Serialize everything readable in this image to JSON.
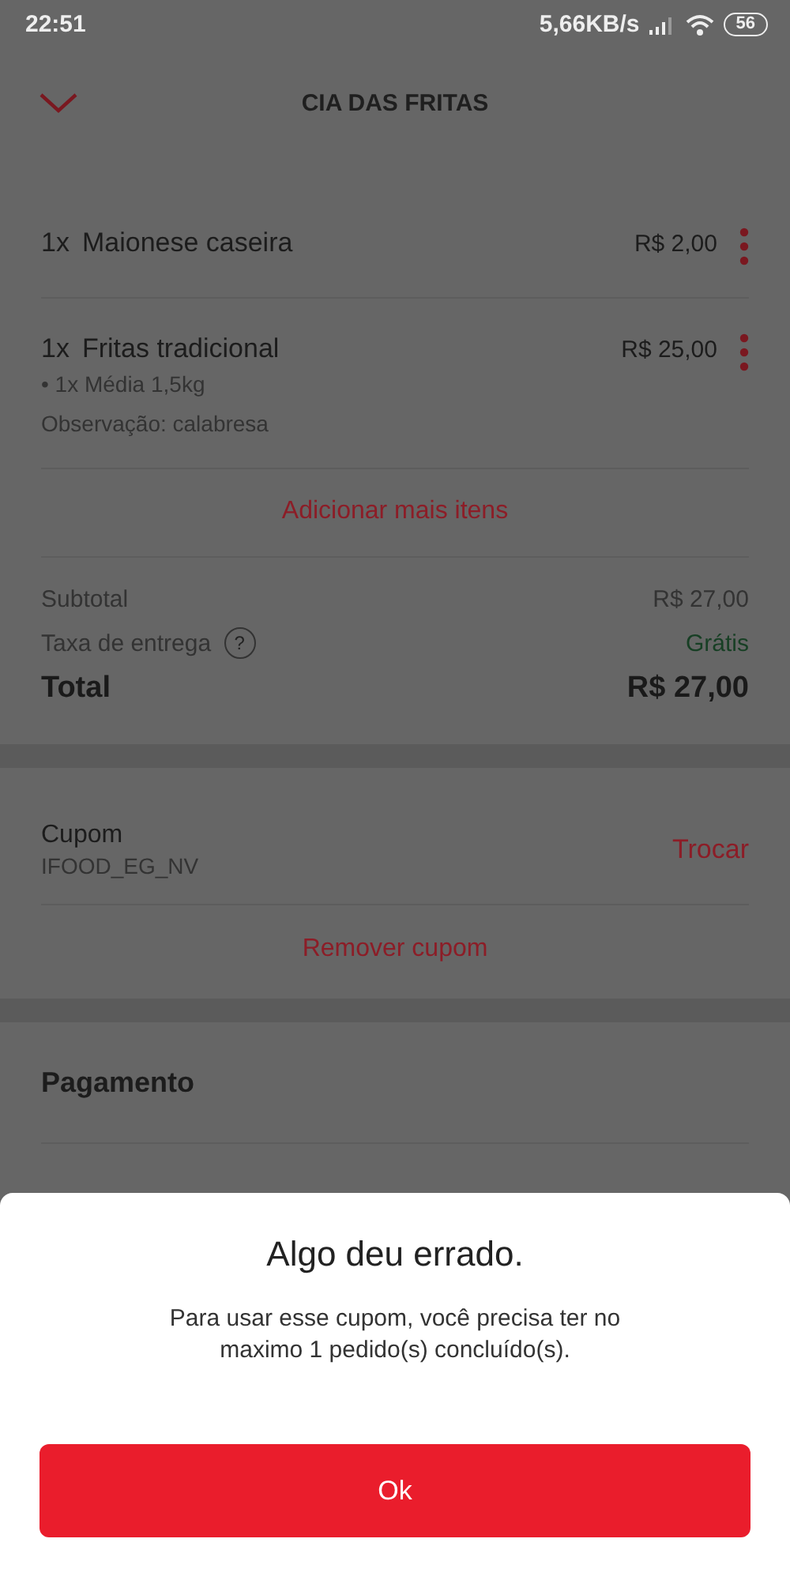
{
  "status_bar": {
    "time": "22:51",
    "network_speed": "5,66KB/s",
    "battery": "56"
  },
  "header": {
    "title": "CIA DAS FRITAS"
  },
  "items": [
    {
      "quantity": "1x",
      "name": "Maionese caseira",
      "price": "R$ 2,00"
    },
    {
      "quantity": "1x",
      "name": "Fritas tradicional",
      "price": "R$ 25,00",
      "details": [
        "• 1x Média 1,5kg",
        "Observação: calabresa"
      ]
    }
  ],
  "add_more": "Adicionar mais itens",
  "summary": {
    "subtotal_label": "Subtotal",
    "subtotal": "R$ 27,00",
    "fee_label": "Taxa de entrega",
    "help": "?",
    "fee": "Grátis",
    "total_label": "Total",
    "total": "R$ 27,00"
  },
  "coupon": {
    "label": "Cupom",
    "code": "IFOOD_EG_NV",
    "change": "Trocar",
    "remove": "Remover cupom"
  },
  "payment": {
    "title": "Pagamento"
  },
  "dialog": {
    "title": "Algo deu errado.",
    "message": "Para usar esse cupom, você precisa ter no maximo 1 pedido(s) concluído(s).",
    "button": "Ok"
  }
}
